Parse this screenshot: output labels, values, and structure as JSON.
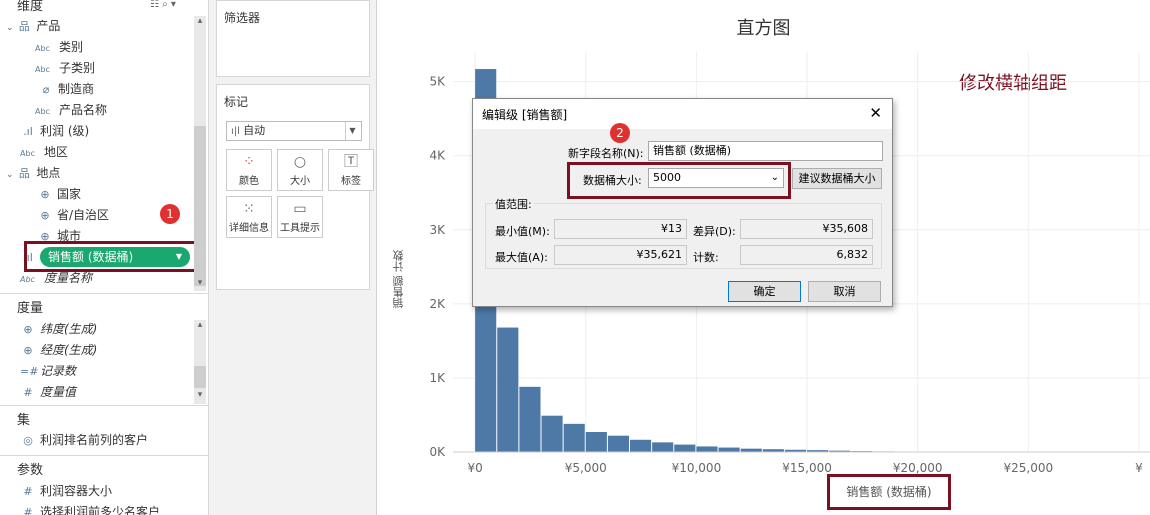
{
  "sidebar": {
    "dimensions_header": "维度",
    "dims": [
      {
        "label": "产品",
        "icon": "hierarchy-icon"
      },
      {
        "label": "类别",
        "icon": "abc"
      },
      {
        "label": "子类别",
        "icon": "abc"
      },
      {
        "label": "制造商",
        "icon": "paperclip-icon"
      },
      {
        "label": "产品名称",
        "icon": "abc"
      },
      {
        "label": "利润 (级)",
        "icon": "bin-icon"
      },
      {
        "label": "地区",
        "icon": "abc"
      },
      {
        "label": "地点",
        "icon": "hierarchy-icon"
      },
      {
        "label": "国家",
        "icon": "globe-icon"
      },
      {
        "label": "省/自治区",
        "icon": "globe-icon"
      },
      {
        "label": "城市",
        "icon": "globe-icon"
      }
    ],
    "selected_field": "销售额 (数据桶)",
    "measure_names": "度量名称",
    "measures_header": "度量",
    "measures": [
      "纬度(生成)",
      "经度(生成)",
      "记录数",
      "度量值"
    ],
    "sets_header": "集",
    "sets": [
      "利润排名前列的客户"
    ],
    "params_header": "参数",
    "params": [
      "利润容器大小",
      "选择利润前多少名客户"
    ],
    "abc_text": "Abc"
  },
  "filters": {
    "title": "筛选器"
  },
  "marks": {
    "title": "标记",
    "mark_type": "自动",
    "buttons": [
      "颜色",
      "大小",
      "标签",
      "详细信息",
      "工具提示"
    ]
  },
  "chart": {
    "title": "直方图",
    "annotation": "修改横轴组距",
    "ylabel": "销售额 计数",
    "xlabel": "销售额 (数据桶)",
    "bar_color": "#4e79a7",
    "annot_color": "#7a1020"
  },
  "chart_data": {
    "type": "bar",
    "title": "直方图",
    "xlabel": "销售额 (数据桶)",
    "ylabel": "销售额 计数",
    "bin_size": 1000,
    "x_bins": [
      0,
      1000,
      2000,
      3000,
      4000,
      5000,
      6000,
      7000,
      8000,
      9000,
      10000,
      11000,
      12000,
      13000,
      14000,
      15000,
      16000,
      17000,
      18000,
      19000
    ],
    "values": [
      5170,
      1680,
      880,
      490,
      380,
      270,
      220,
      165,
      130,
      100,
      75,
      60,
      45,
      38,
      30,
      25,
      18,
      12,
      8,
      6
    ],
    "xticks": [
      "¥0",
      "¥5,000",
      "¥10,000",
      "¥15,000",
      "¥20,000",
      "¥25,000",
      "¥"
    ],
    "yticks": [
      "0K",
      "1K",
      "2K",
      "3K",
      "4K",
      "5K"
    ],
    "ylim": [
      0,
      5400
    ],
    "xlim": [
      -1000,
      30500
    ],
    "grid": true
  },
  "dialog": {
    "title": "编辑级 [销售额]",
    "name_label": "新字段名称(N):",
    "name_value": "销售额 (数据桶)",
    "bin_label": "数据桶大小:",
    "bin_value": "5000",
    "suggest_button": "建议数据桶大小",
    "range_title": "值范围:",
    "min_label": "最小值(M):",
    "min_value": "¥13",
    "diff_label": "差异(D):",
    "diff_value": "¥35,608",
    "max_label": "最大值(A):",
    "max_value": "¥35,621",
    "count_label": "计数:",
    "count_value": "6,832",
    "ok": "确定",
    "cancel": "取消",
    "close_glyph": "✕"
  },
  "badges": {
    "one": "1",
    "two": "2"
  }
}
